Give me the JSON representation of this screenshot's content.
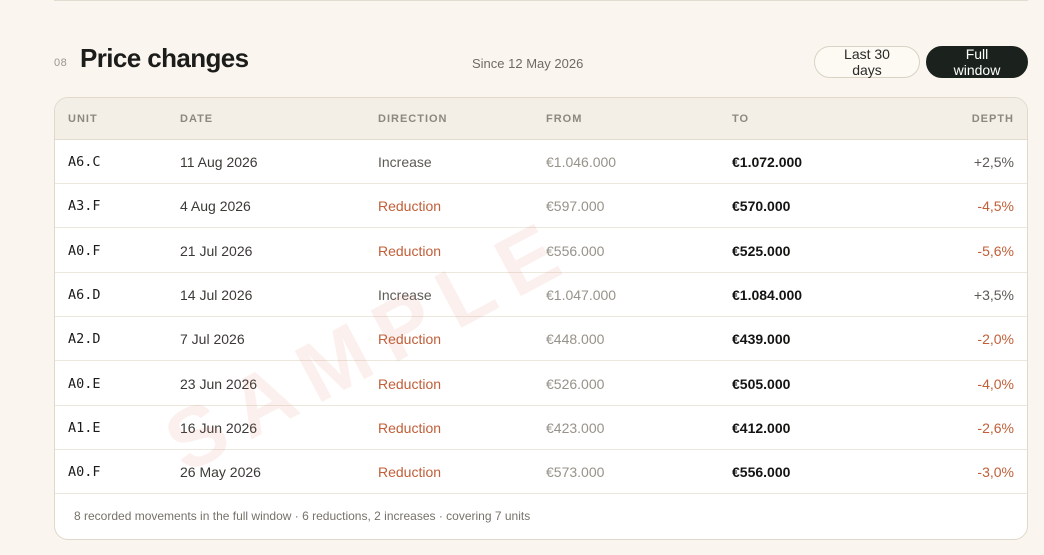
{
  "section": {
    "number": "08",
    "title": "Price changes",
    "since": "Since 12 May 2026"
  },
  "filters": {
    "last30_label": "Last 30 days",
    "full_label": "Full window",
    "active": "full"
  },
  "table": {
    "headers": {
      "unit": "UNIT",
      "date": "DATE",
      "direction": "DIRECTION",
      "from": "FROM",
      "to": "TO",
      "depth": "DEPTH"
    },
    "rows": [
      {
        "unit": "A6.C",
        "date": "11 Aug 2026",
        "direction": "Increase",
        "from": "€1.046.000",
        "to": "€1.072.000",
        "depth": "+2,5%"
      },
      {
        "unit": "A3.F",
        "date": "4 Aug 2026",
        "direction": "Reduction",
        "from": "€597.000",
        "to": "€570.000",
        "depth": "-4,5%"
      },
      {
        "unit": "A0.F",
        "date": "21 Jul 2026",
        "direction": "Reduction",
        "from": "€556.000",
        "to": "€525.000",
        "depth": "-5,6%"
      },
      {
        "unit": "A6.D",
        "date": "14 Jul 2026",
        "direction": "Increase",
        "from": "€1.047.000",
        "to": "€1.084.000",
        "depth": "+3,5%"
      },
      {
        "unit": "A2.D",
        "date": "7 Jul 2026",
        "direction": "Reduction",
        "from": "€448.000",
        "to": "€439.000",
        "depth": "-2,0%"
      },
      {
        "unit": "A0.E",
        "date": "23 Jun 2026",
        "direction": "Reduction",
        "from": "€526.000",
        "to": "€505.000",
        "depth": "-4,0%"
      },
      {
        "unit": "A1.E",
        "date": "16 Jun 2026",
        "direction": "Reduction",
        "from": "€423.000",
        "to": "€412.000",
        "depth": "-2,6%"
      },
      {
        "unit": "A0.F",
        "date": "26 May 2026",
        "direction": "Reduction",
        "from": "€573.000",
        "to": "€556.000",
        "depth": "-3,0%"
      }
    ],
    "footer": "8 recorded movements in the full window · 6 reductions, 2 increases · covering 7 units"
  },
  "watermark": "SAMPLE",
  "colors": {
    "reduction": "#c05f38",
    "increase": "#5c5a55",
    "active_button": "#1b221d",
    "background": "#faf6ef"
  }
}
